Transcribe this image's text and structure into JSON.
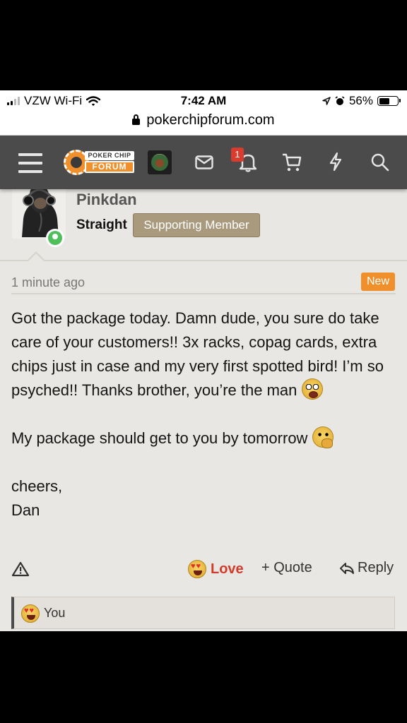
{
  "status_bar": {
    "carrier": "VZW Wi-Fi",
    "time": "7:42 AM",
    "battery": "56%",
    "battery_level": 0.56
  },
  "url_bar": {
    "domain": "pokerchipforum.com"
  },
  "nav": {
    "logo_top": "POKER CHIP",
    "logo_bottom": "FORUM",
    "notification_count": "1"
  },
  "post": {
    "username": "Pinkdan",
    "user_title": "Straight",
    "member_badge": "Supporting Member",
    "timestamp": "1 minute ago",
    "new_label": "New",
    "line1": "Got the package today. Damn dude, you sure do take care of your customers!! 3x racks, copag cards, extra chips just in case and my very first spotted bird! I’m so psyched!! Thanks brother, you’re the man",
    "line2": "My package should get to you by tomorrow",
    "line3a": "cheers,",
    "line3b": "Dan"
  },
  "actions": {
    "love": "Love",
    "quote": "+ Quote",
    "reply": "Reply"
  },
  "reactions": {
    "you": "You"
  },
  "colors": {
    "accent_orange": "#f0902c",
    "nav_bg": "#4b4b4b",
    "love_red": "#d23b2a",
    "online_green": "#4fbe5b",
    "badge_bg": "#aa9a7d"
  }
}
